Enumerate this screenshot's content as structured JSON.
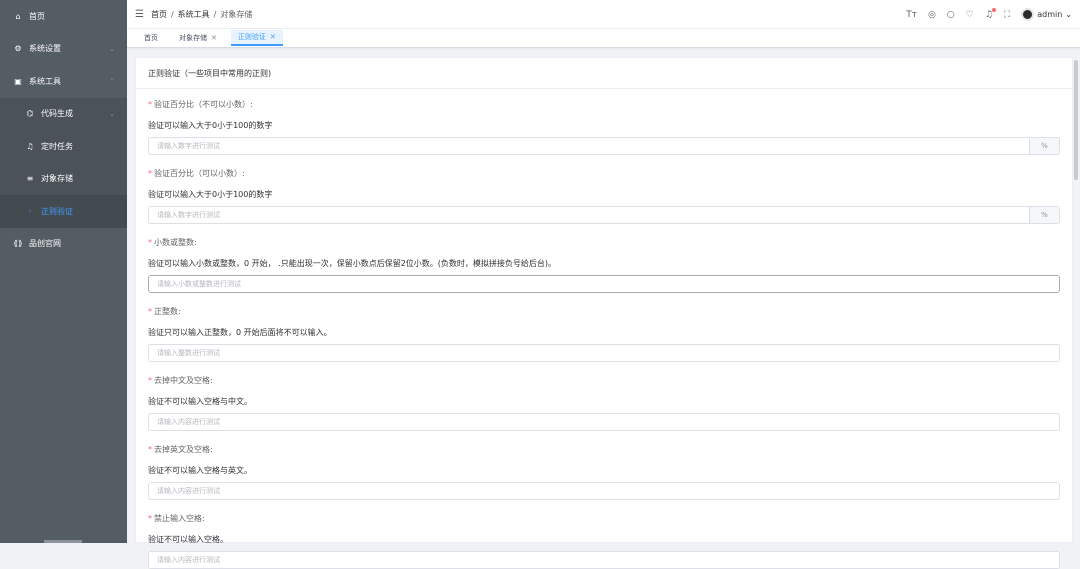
{
  "sidebar": {
    "items": [
      {
        "label": "首页",
        "icon": "home-icon",
        "glyph": "⌂",
        "arrow": ""
      },
      {
        "label": "系统设置",
        "icon": "settings-icon",
        "glyph": "⚙",
        "arrow": "⌄"
      },
      {
        "label": "系统工具",
        "icon": "tools-icon",
        "glyph": "▣",
        "arrow": "⌃"
      },
      {
        "label": "代码生成",
        "icon": "code-icon",
        "glyph": "⌬",
        "arrow": "⌄"
      },
      {
        "label": "定时任务",
        "icon": "bell-icon",
        "glyph": "♫",
        "arrow": ""
      },
      {
        "label": "对象存储",
        "icon": "storage-icon",
        "glyph": "≡",
        "arrow": ""
      },
      {
        "label": "正则验证",
        "icon": "validate-icon",
        "glyph": "◦",
        "arrow": ""
      },
      {
        "label": "品创官网",
        "icon": "link-icon",
        "glyph": "⟪⟫",
        "arrow": ""
      }
    ]
  },
  "navbar": {
    "breadcrumb": [
      "首页",
      "系统工具",
      "对象存储"
    ],
    "separator": "/",
    "username": "admin"
  },
  "tags": [
    {
      "label": "首页",
      "closable": false
    },
    {
      "label": "对象存储",
      "closable": true
    },
    {
      "label": "正则验证",
      "closable": true
    }
  ],
  "card": {
    "title": "正则验证（一些项目中常用的正则)",
    "fields": [
      {
        "label": "验证百分比（不可以小数）:",
        "desc": "验证可以输入大于0小于100的数字",
        "placeholder": "请输入数字进行测试",
        "append": "%"
      },
      {
        "label": "验证百分比（可以小数）:",
        "desc": "验证可以输入大于0小于100的数字",
        "placeholder": "请输入数字进行测试",
        "append": "%"
      },
      {
        "label": "小数或整数:",
        "desc": "验证可以输入小数或整数，0 开始， .只能出现一次，保留小数点后保留2位小数。(负数时，模拟拼接负号给后台)。",
        "placeholder": "请输入小数或整数进行测试",
        "append": ""
      },
      {
        "label": "正整数:",
        "desc": "验证只可以输入正整数，0 开始后面将不可以输入。",
        "placeholder": "请输入整数进行测试",
        "append": ""
      },
      {
        "label": "去掉中文及空格:",
        "desc": "验证不可以输入空格与中文。",
        "placeholder": "请输入内容进行测试",
        "append": ""
      },
      {
        "label": "去掉英文及空格:",
        "desc": "验证不可以输入空格与英文。",
        "placeholder": "请输入内容进行测试",
        "append": ""
      },
      {
        "label": "禁止输入空格:",
        "desc": "验证不可以输入空格。",
        "placeholder": "请输入内容进行测试",
        "append": ""
      }
    ]
  },
  "colors": {
    "primary": "#409eff",
    "sidebar_bg": "#545c64",
    "required": "#f56c6c"
  }
}
